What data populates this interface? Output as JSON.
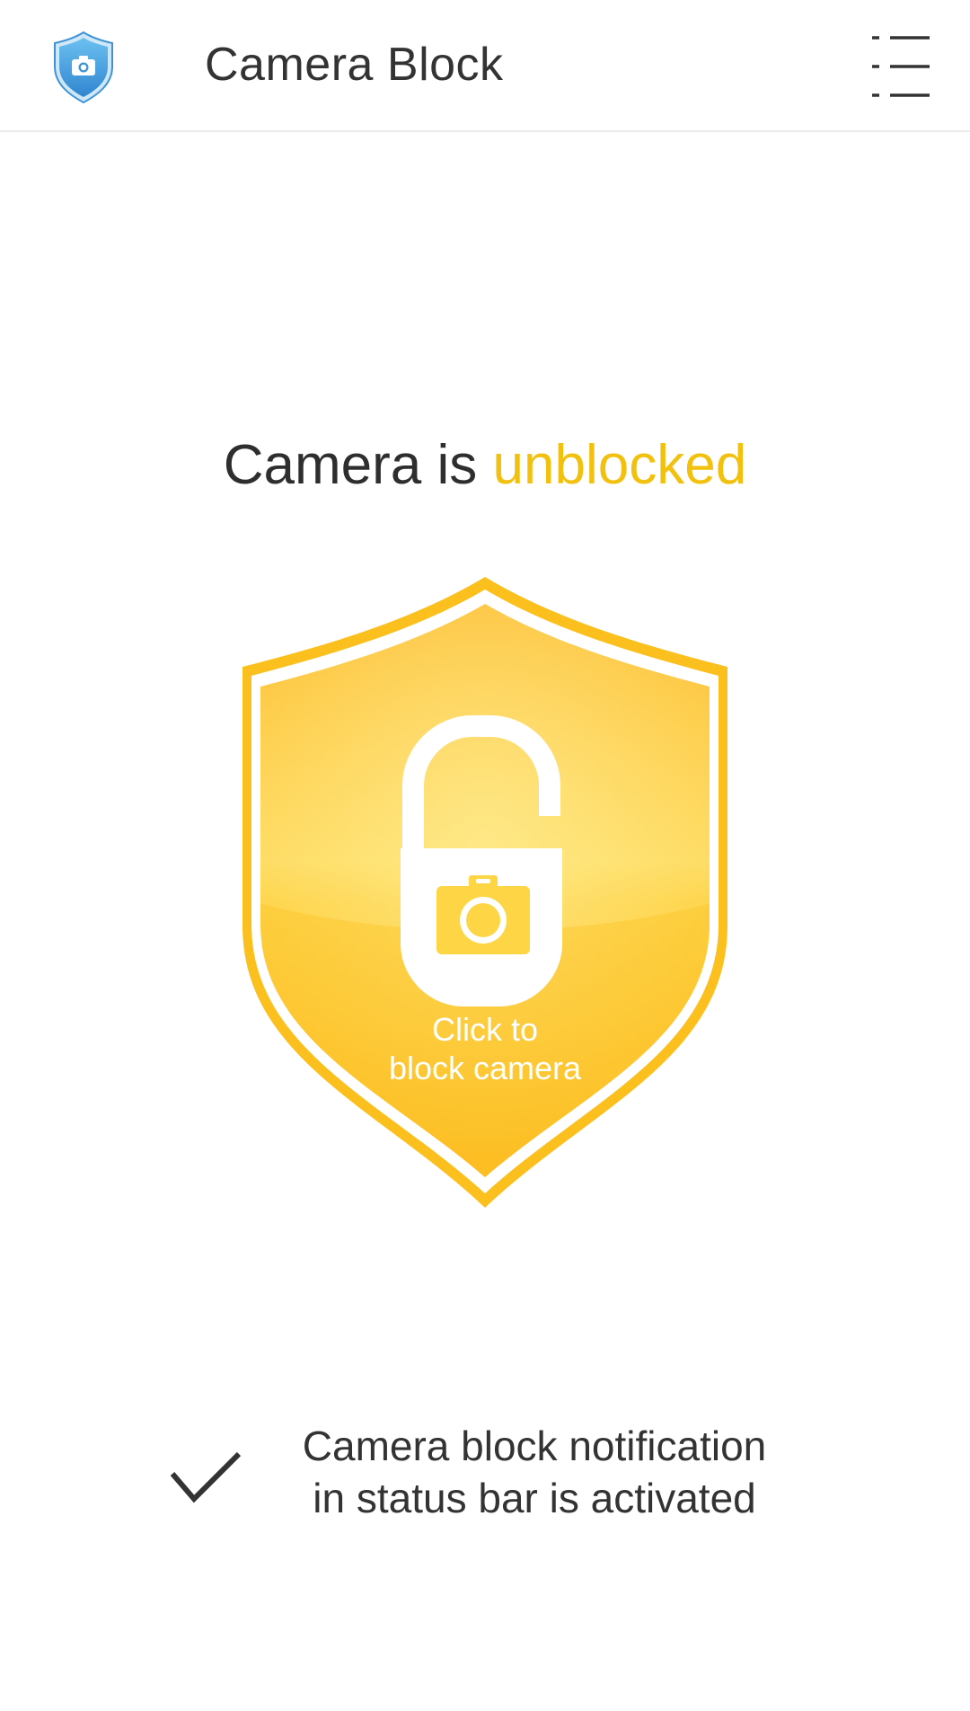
{
  "appbar": {
    "title": "Camera Block",
    "logo_icon": "shield-camera-icon",
    "menu_icon": "list-menu-icon"
  },
  "status": {
    "prefix": "Camera is ",
    "state": "unblocked"
  },
  "shield": {
    "icon": "unlocked-padlock-camera-icon",
    "label_line1": "Click to",
    "label_line2": "block camera"
  },
  "notification": {
    "icon": "check-icon",
    "line1": "Camera block notification",
    "line2": "in status bar is activated"
  },
  "colors": {
    "accent": "#f2c00e",
    "shield_yellow": "#fbbf1e",
    "logo_blue": "#4aa3e0",
    "text_dark": "#333333"
  }
}
